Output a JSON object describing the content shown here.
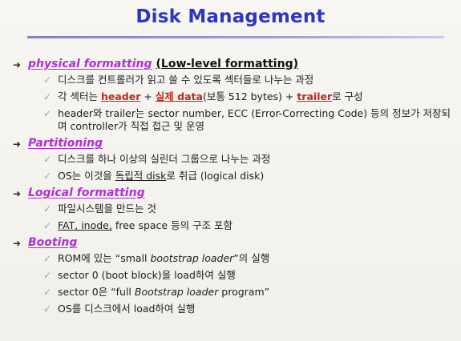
{
  "slide": {
    "title": "Disk Management"
  },
  "sections": [
    {
      "title": "physical formatting",
      "paren": "(Low-level formatting)",
      "items": [
        {
          "text": "디스크를 컨트롤러가 읽고 쓸 수 있도록 섹터들로 나누는 과정"
        },
        {
          "p1": "각 섹터는 ",
          "header": "header",
          "p2": " + ",
          "data": "실제 data",
          "p3": "(보통 512 bytes) + ",
          "trailer": "trailer",
          "p4": "로 구성"
        },
        {
          "text": "header와 trailer는 sector number, ECC (Error-Correcting Code) 등의 정보가 저장되며 controller가 직접 접근 및 운영"
        }
      ]
    },
    {
      "title": "Partitioning",
      "items": [
        {
          "text": "디스크를 하나 이상의 실린더 그룹으로 나누는 과정"
        },
        {
          "p1": "OS는 이것을 ",
          "u": "독립적 disk",
          "p2": "로 취급 (logical disk)"
        }
      ]
    },
    {
      "title": "Logical formatting",
      "items": [
        {
          "text": "파일시스템을 만드는 것"
        },
        {
          "u": "FAT, inode,",
          "p2": " free space 등의 구조 포함"
        }
      ]
    },
    {
      "title": "Booting",
      "items": [
        {
          "p1": "ROM에 있는 “small ",
          "it": "bootstrap loader",
          "p2": "”의 실행"
        },
        {
          "text": "sector 0 (boot block)을 load하여 실행"
        },
        {
          "p1": "sector 0은  “full ",
          "it": "Bootstrap loader",
          "p2": " program”"
        },
        {
          "text": "OS를 디스크에서 load하여 실행"
        }
      ]
    }
  ],
  "icons": {
    "section_bullet": "arrow-bullet-icon",
    "item_bullet": "checkmark-icon"
  },
  "colors": {
    "title": "#2e34c4",
    "section_title": "#b02fd4",
    "highlight": "#c0281a",
    "checkmark": "#9a9dd2"
  }
}
